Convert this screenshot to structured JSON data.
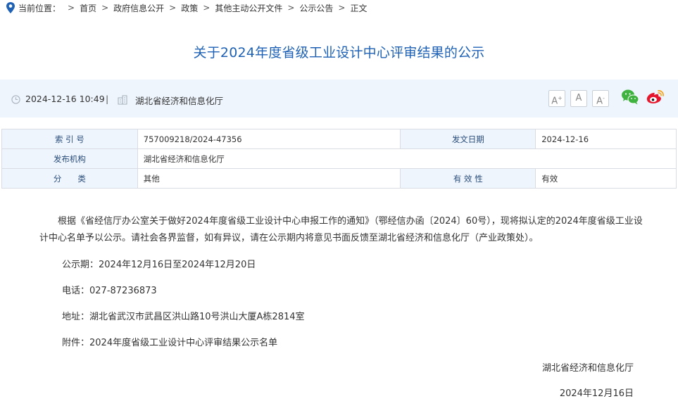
{
  "breadcrumb": {
    "label": "当前位置：",
    "items": [
      "首页",
      "政府信息公开",
      "政策",
      "其他主动公开文件",
      "公示公告",
      "正文"
    ]
  },
  "article": {
    "title": "关于2024年度省级工业设计中心评审结果的公示",
    "datetime": "2024-12-16 10:49",
    "source": "湖北省经济和信息化厅"
  },
  "font_controls": {
    "large": "A",
    "medium": "A",
    "small": "A"
  },
  "meta": {
    "index_label": "索 引 号",
    "index_value": "757009218/2024-47356",
    "date_label": "发文日期",
    "date_value": "2024-12-16",
    "org_label": "发布机构",
    "org_value": "湖北省经济和信息化厅",
    "category_label": "分　　类",
    "category_value": "其他",
    "validity_label": "有 效 性",
    "validity_value": "有效"
  },
  "body": {
    "paragraph": "根据《省经信厅办公室关于做好2024年度省级工业设计中心申报工作的通知》（鄂经信办函〔2024〕60号），现将拟认定的2024年度省级工业设计中心名单予以公示。请社会各界监督，如有异议，请在公示期内将意见书面反馈至湖北省经济和信息化厅（产业政策处）。",
    "period": "公示期：2024年12月16日至2024年12月20日",
    "phone": "电话：027-87236873",
    "address": "地址：湖北省武汉市武昌区洪山路10号洪山大厦A栋2814室",
    "attachment_prefix": "附件：",
    "attachment_link": "2024年度省级工业设计中心评审结果公示名单",
    "signature": "湖北省经济和信息化厅",
    "sign_date": "2024年12月16日"
  },
  "colors": {
    "title": "#1f62b5",
    "infobar_bg": "#eef5fd",
    "wechat": "#3fb23f",
    "weibo": "#e6162d",
    "weibo_eye": "#f5a623"
  }
}
